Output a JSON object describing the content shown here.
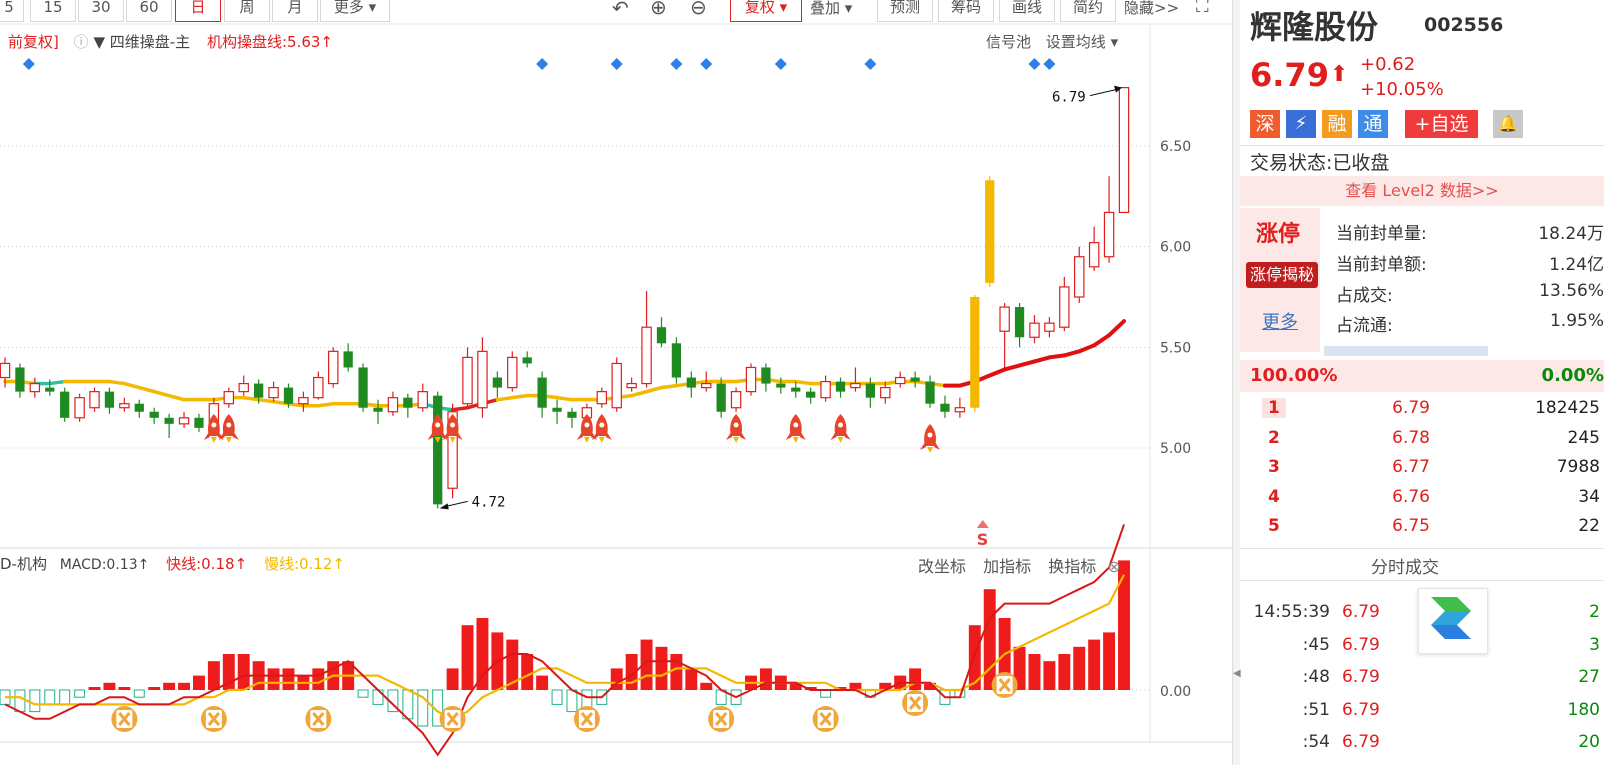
{
  "toolbar": {
    "periods": [
      "5",
      "15",
      "30",
      "60",
      "日",
      "周",
      "月"
    ],
    "active_period": "日",
    "more": "更多",
    "fuquan": "复权",
    "overlay": "叠加",
    "forecast": "预测",
    "chips": "筹码",
    "draw": "画线",
    "simple": "简约",
    "hide": "隐藏>>"
  },
  "main_chart": {
    "title_left": "前复权]",
    "indicator_name": "四维操盘-主",
    "inst_line_label": "机构操盘线:5.63↑",
    "signal_pool": "信号池",
    "set_ma": "设置均线",
    "y_ticks": [
      "6.50",
      "6.00",
      "5.50",
      "5.00"
    ],
    "high_label": "6.79",
    "low_label": "4.72",
    "sell_marker": "S"
  },
  "sub_chart": {
    "name": "D-机构",
    "macd_label": "MACD:0.13↑",
    "fast_label": "快线:0.18↑",
    "slow_label": "慢线:0.12↑",
    "change_coord": "改坐标",
    "add_indicator": "加指标",
    "switch_indicator": "换指标",
    "y_tick": "0.00"
  },
  "chart_data": {
    "type": "candlestick",
    "ylim": [
      4.6,
      6.9
    ],
    "candles": [
      [
        5.35,
        5.42,
        5.45,
        5.3
      ],
      [
        5.4,
        5.28,
        5.42,
        5.25
      ],
      [
        5.28,
        5.32,
        5.35,
        5.25
      ],
      [
        5.3,
        5.28,
        5.34,
        5.26
      ],
      [
        5.28,
        5.15,
        5.3,
        5.13
      ],
      [
        5.15,
        5.25,
        5.27,
        5.13
      ],
      [
        5.2,
        5.28,
        5.3,
        5.18
      ],
      [
        5.28,
        5.2,
        5.3,
        5.17
      ],
      [
        5.2,
        5.22,
        5.25,
        5.18
      ],
      [
        5.22,
        5.18,
        5.24,
        5.15
      ],
      [
        5.18,
        5.15,
        5.2,
        5.12
      ],
      [
        5.15,
        5.12,
        5.17,
        5.05
      ],
      [
        5.12,
        5.15,
        5.18,
        5.1
      ],
      [
        5.15,
        5.1,
        5.17,
        5.08
      ],
      [
        5.12,
        5.22,
        5.25,
        5.1
      ],
      [
        5.22,
        5.28,
        5.3,
        5.2
      ],
      [
        5.28,
        5.32,
        5.36,
        5.26
      ],
      [
        5.32,
        5.25,
        5.34,
        5.22
      ],
      [
        5.25,
        5.3,
        5.33,
        5.23
      ],
      [
        5.3,
        5.22,
        5.32,
        5.2
      ],
      [
        5.22,
        5.25,
        5.28,
        5.18
      ],
      [
        5.25,
        5.35,
        5.38,
        5.24
      ],
      [
        5.32,
        5.48,
        5.5,
        5.3
      ],
      [
        5.48,
        5.4,
        5.52,
        5.38
      ],
      [
        5.4,
        5.2,
        5.42,
        5.18
      ],
      [
        5.2,
        5.18,
        5.24,
        5.12
      ],
      [
        5.18,
        5.25,
        5.28,
        5.16
      ],
      [
        5.25,
        5.2,
        5.27,
        5.15
      ],
      [
        5.2,
        5.28,
        5.32,
        5.18
      ],
      [
        5.26,
        4.72,
        5.28,
        4.7
      ],
      [
        4.8,
        5.18,
        5.22,
        4.75
      ],
      [
        5.22,
        5.45,
        5.5,
        5.2
      ],
      [
        5.2,
        5.48,
        5.55,
        5.15
      ],
      [
        5.35,
        5.3,
        5.38,
        5.25
      ],
      [
        5.3,
        5.45,
        5.48,
        5.28
      ],
      [
        5.45,
        5.42,
        5.48,
        5.4
      ],
      [
        5.35,
        5.2,
        5.38,
        5.15
      ],
      [
        5.2,
        5.18,
        5.24,
        5.12
      ],
      [
        5.18,
        5.15,
        5.2,
        5.1
      ],
      [
        5.15,
        5.2,
        5.22,
        5.12
      ],
      [
        5.22,
        5.28,
        5.3,
        5.2
      ],
      [
        5.2,
        5.42,
        5.45,
        5.18
      ],
      [
        5.3,
        5.32,
        5.35,
        5.28
      ],
      [
        5.32,
        5.6,
        5.78,
        5.3
      ],
      [
        5.6,
        5.52,
        5.65,
        5.5
      ],
      [
        5.52,
        5.35,
        5.55,
        5.32
      ],
      [
        5.35,
        5.3,
        5.38,
        5.25
      ],
      [
        5.3,
        5.32,
        5.38,
        5.28
      ],
      [
        5.32,
        5.18,
        5.35,
        5.15
      ],
      [
        5.2,
        5.28,
        5.3,
        5.18
      ],
      [
        5.28,
        5.4,
        5.42,
        5.26
      ],
      [
        5.4,
        5.32,
        5.42,
        5.28
      ],
      [
        5.32,
        5.3,
        5.35,
        5.27
      ],
      [
        5.3,
        5.28,
        5.33,
        5.25
      ],
      [
        5.28,
        5.25,
        5.3,
        5.22
      ],
      [
        5.25,
        5.33,
        5.36,
        5.23
      ],
      [
        5.33,
        5.28,
        5.35,
        5.25
      ],
      [
        5.3,
        5.32,
        5.4,
        5.28
      ],
      [
        5.32,
        5.25,
        5.35,
        5.2
      ],
      [
        5.25,
        5.3,
        5.33,
        5.22
      ],
      [
        5.32,
        5.35,
        5.38,
        5.3
      ],
      [
        5.35,
        5.33,
        5.38,
        5.3
      ],
      [
        5.33,
        5.22,
        5.36,
        5.2
      ],
      [
        5.22,
        5.18,
        5.26,
        5.15
      ],
      [
        5.18,
        5.2,
        5.25,
        5.15
      ],
      [
        5.2,
        5.75,
        5.76,
        5.18
      ],
      [
        5.82,
        6.33,
        6.35,
        5.8
      ],
      [
        5.58,
        5.7,
        5.72,
        5.4
      ],
      [
        5.7,
        5.55,
        5.72,
        5.5
      ],
      [
        5.55,
        5.62,
        5.66,
        5.52
      ],
      [
        5.58,
        5.62,
        5.65,
        5.55
      ],
      [
        5.6,
        5.8,
        5.85,
        5.58
      ],
      [
        5.75,
        5.95,
        6.0,
        5.72
      ],
      [
        5.9,
        6.02,
        6.1,
        5.88
      ],
      [
        5.95,
        6.17,
        6.35,
        5.92
      ],
      [
        6.17,
        6.79,
        6.79,
        6.2
      ]
    ],
    "inst_line": [
      5.33,
      5.33,
      5.32,
      5.32,
      5.33,
      5.33,
      5.33,
      5.33,
      5.32,
      5.3,
      5.28,
      5.26,
      5.24,
      5.24,
      5.24,
      5.25,
      5.25,
      5.24,
      5.23,
      5.22,
      5.21,
      5.21,
      5.22,
      5.22,
      5.22,
      5.21,
      5.21,
      5.21,
      5.22,
      5.2,
      5.19,
      5.2,
      5.22,
      5.24,
      5.25,
      5.26,
      5.26,
      5.25,
      5.24,
      5.24,
      5.24,
      5.25,
      5.26,
      5.28,
      5.3,
      5.31,
      5.32,
      5.33,
      5.33,
      5.33,
      5.34,
      5.34,
      5.33,
      5.33,
      5.32,
      5.32,
      5.32,
      5.32,
      5.32,
      5.32,
      5.33,
      5.33,
      5.32,
      5.31,
      5.31,
      5.33,
      5.36,
      5.39,
      5.41,
      5.43,
      5.45,
      5.46,
      5.48,
      5.51,
      5.56,
      5.63
    ],
    "macd_hist": [
      -0.02,
      -0.03,
      -0.03,
      -0.02,
      -0.02,
      -0.01,
      0.0,
      0.01,
      0.0,
      -0.01,
      0.0,
      0.01,
      0.01,
      0.02,
      0.04,
      0.05,
      0.05,
      0.04,
      0.03,
      0.03,
      0.02,
      0.03,
      0.04,
      0.04,
      -0.01,
      -0.02,
      -0.03,
      -0.04,
      -0.05,
      -0.05,
      0.03,
      0.09,
      0.1,
      0.08,
      0.07,
      0.05,
      0.02,
      -0.02,
      -0.03,
      -0.04,
      -0.02,
      0.03,
      0.05,
      0.07,
      0.06,
      0.05,
      0.03,
      0.01,
      -0.02,
      -0.02,
      0.02,
      0.03,
      0.02,
      0.01,
      0.0,
      -0.01,
      0.0,
      0.01,
      -0.01,
      0.01,
      0.02,
      0.03,
      0.01,
      -0.02,
      -0.01,
      0.09,
      0.14,
      0.1,
      0.06,
      0.05,
      0.04,
      0.05,
      0.06,
      0.07,
      0.08,
      0.18
    ],
    "fast": [
      -0.02,
      -0.03,
      -0.04,
      -0.04,
      -0.03,
      -0.02,
      -0.02,
      -0.01,
      -0.01,
      -0.02,
      -0.02,
      -0.02,
      -0.01,
      -0.01,
      0.0,
      0.01,
      0.02,
      0.02,
      0.02,
      0.02,
      0.02,
      0.02,
      0.03,
      0.04,
      0.02,
      0.0,
      -0.02,
      -0.04,
      -0.06,
      -0.09,
      -0.06,
      -0.01,
      0.02,
      0.04,
      0.05,
      0.05,
      0.04,
      0.02,
      0.0,
      -0.01,
      -0.01,
      0.01,
      0.02,
      0.04,
      0.04,
      0.04,
      0.03,
      0.02,
      0.0,
      -0.01,
      0.0,
      0.01,
      0.01,
      0.01,
      0.0,
      0.0,
      0.0,
      0.0,
      -0.01,
      0.0,
      0.01,
      0.01,
      0.01,
      -0.01,
      -0.01,
      0.05,
      0.1,
      0.12,
      0.12,
      0.12,
      0.12,
      0.13,
      0.14,
      0.15,
      0.17,
      0.23
    ],
    "slow": [
      -0.01,
      -0.01,
      -0.02,
      -0.02,
      -0.02,
      -0.02,
      -0.02,
      -0.02,
      -0.02,
      -0.02,
      -0.02,
      -0.02,
      -0.02,
      -0.01,
      -0.01,
      0.0,
      0.0,
      0.01,
      0.01,
      0.01,
      0.01,
      0.01,
      0.02,
      0.02,
      0.02,
      0.02,
      0.01,
      0.0,
      -0.01,
      -0.03,
      -0.04,
      -0.03,
      -0.01,
      0.0,
      0.01,
      0.02,
      0.03,
      0.03,
      0.02,
      0.01,
      0.01,
      0.01,
      0.01,
      0.02,
      0.02,
      0.03,
      0.03,
      0.03,
      0.02,
      0.01,
      0.01,
      0.01,
      0.01,
      0.01,
      0.01,
      0.01,
      0.0,
      0.0,
      0.0,
      0.0,
      0.0,
      0.01,
      0.01,
      0.0,
      0.0,
      0.01,
      0.03,
      0.05,
      0.06,
      0.07,
      0.08,
      0.09,
      0.1,
      0.11,
      0.12,
      0.16
    ],
    "rocket_signals": [
      14,
      15,
      29,
      30,
      39,
      40,
      49,
      53,
      56,
      62
    ],
    "x_signals": [
      8,
      14,
      21,
      30,
      39,
      48,
      55,
      61,
      67
    ],
    "diamond_signals": [
      2,
      36,
      41,
      45,
      47,
      52,
      58,
      69,
      70
    ]
  },
  "quote": {
    "name": "辉隆股份",
    "code": "002556",
    "price": "6.79",
    "arrow": "⬆",
    "change": "+0.62",
    "change_pct": "+10.05%",
    "tags": [
      "深",
      "融",
      "通"
    ],
    "add_watch": "+自选",
    "trade_status_label": "交易状态:",
    "trade_status": "已收盘",
    "level2": "查看 Level2 数据>>",
    "limit_up": "涨停",
    "limit_up_secret": "涨停揭秘",
    "more": "更多",
    "seal_vol_label": "当前封单量:",
    "seal_vol": "18.24万",
    "seal_amt_label": "当前封单额:",
    "seal_amt": "1.24亿",
    "turnover_label": "占成交:",
    "turnover": "13.56%",
    "float_label": "占流通:",
    "float": "1.95%",
    "buy_ratio": "100.00%",
    "sell_ratio": "0.00%",
    "book": [
      {
        "lvl": "1",
        "price": "6.79",
        "vol": "182425"
      },
      {
        "lvl": "2",
        "price": "6.78",
        "vol": "245"
      },
      {
        "lvl": "3",
        "price": "6.77",
        "vol": "7988"
      },
      {
        "lvl": "4",
        "price": "6.76",
        "vol": "34"
      },
      {
        "lvl": "5",
        "price": "6.75",
        "vol": "22"
      }
    ],
    "ticks_title": "分时成交",
    "ticks": [
      {
        "t": "14:55:39",
        "p": "6.79",
        "v": "2"
      },
      {
        "t": ":45",
        "p": "6.79",
        "v": "3"
      },
      {
        "t": ":48",
        "p": "6.79",
        "v": "27"
      },
      {
        "t": ":51",
        "p": "6.79",
        "v": "180"
      },
      {
        "t": ":54",
        "p": "6.79",
        "v": "20"
      }
    ]
  }
}
